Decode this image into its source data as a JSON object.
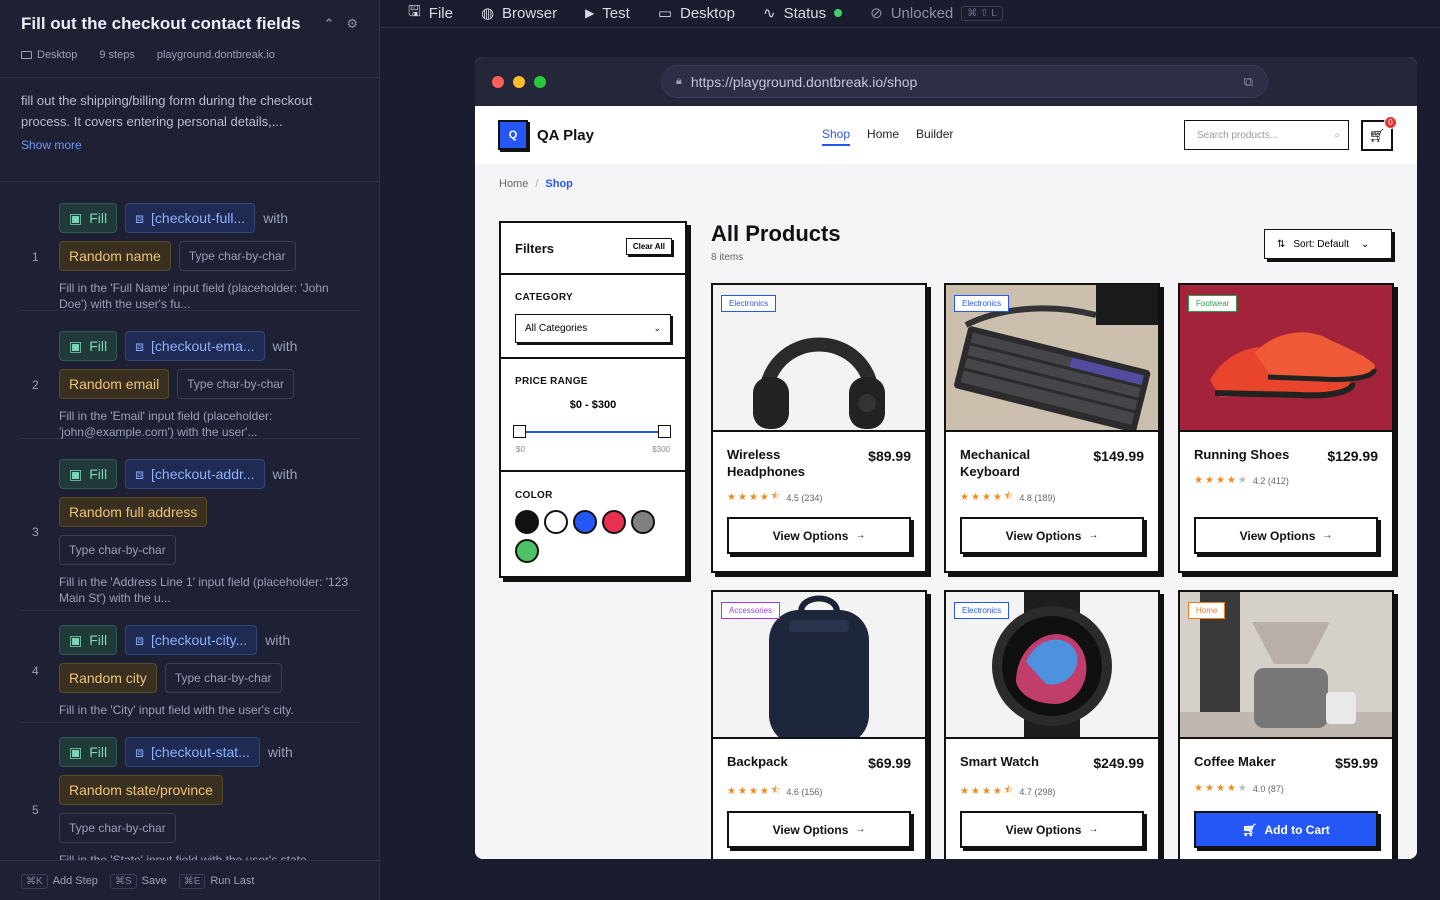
{
  "panel": {
    "title": "Fill out the checkout contact fields",
    "meta": {
      "device": "Desktop",
      "steps": "9 steps",
      "domain": "playground.dontbreak.io"
    },
    "description": "fill out the shipping/billing form during the checkout process. It covers entering personal details,...",
    "show_more": "Show more",
    "steps": [
      {
        "num": "1",
        "action": "Fill",
        "target": "[checkout-full...",
        "with": "with",
        "value": "Random name",
        "mode": "Type char-by-char",
        "desc": "Fill in the 'Full Name' input field (placeholder: 'John Doe') with the user's fu..."
      },
      {
        "num": "2",
        "action": "Fill",
        "target": "[checkout-ema...",
        "with": "with",
        "value": "Random email",
        "mode": "Type char-by-char",
        "desc": "Fill in the 'Email' input field (placeholder: 'john@example.com') with the user'..."
      },
      {
        "num": "3",
        "action": "Fill",
        "target": "[checkout-addr...",
        "with": "with",
        "value": "Random full address",
        "mode": "Type char-by-char",
        "desc": "Fill in the 'Address Line 1' input field (placeholder: '123 Main St') with the u..."
      },
      {
        "num": "4",
        "action": "Fill",
        "target": "[checkout-city...",
        "with": "with",
        "value": "Random city",
        "mode": "Type char-by-char",
        "desc": "Fill in the 'City' input field with the user's city."
      },
      {
        "num": "5",
        "action": "Fill",
        "target": "[checkout-stat...",
        "with": "with",
        "value": "Random state/province",
        "mode": "Type char-by-char",
        "desc": "Fill in the 'State' input field with the user's state..."
      }
    ],
    "footer": {
      "add_kbd": "⌘K",
      "add": "Add Step",
      "save_kbd": "⌘S",
      "save": "Save",
      "run_kbd": "⌘E",
      "run": "Run Last"
    }
  },
  "topbar": {
    "file": "File",
    "browser": "Browser",
    "test": "Test",
    "desktop": "Desktop",
    "status": "Status",
    "unlocked": "Unlocked",
    "unlock_kbd": "⌘ ⇧ L"
  },
  "browser": {
    "url": "https://playground.dontbreak.io/shop"
  },
  "shop": {
    "logo": "Q",
    "brand": "QA Play",
    "nav": [
      "Shop",
      "Home",
      "Builder"
    ],
    "search_placeholder": "Search products...",
    "cart_count": "0",
    "breadcrumb": {
      "home": "Home",
      "sep": "/",
      "current": "Shop"
    },
    "filters": {
      "title": "Filters",
      "clear": "Clear All",
      "category_label": "CATEGORY",
      "category_value": "All Categories",
      "price_label": "PRICE RANGE",
      "price_value": "$0 - $300",
      "min": "$0",
      "max": "$300",
      "color_label": "COLOR"
    },
    "colors": [
      "#111111",
      "#ffffff",
      "#2457f5",
      "#e8304f",
      "#808080",
      "#4cc265"
    ],
    "title": "All Products",
    "count": "8 items",
    "sort": "Sort: Default",
    "products": [
      {
        "name": "Wireless Headphones",
        "price": "$89.99",
        "tag": "Electronics",
        "rating": "4.5 (234)",
        "stars": 4.5,
        "button": "View Options"
      },
      {
        "name": "Mechanical Keyboard",
        "price": "$149.99",
        "tag": "Electronics",
        "rating": "4.8 (189)",
        "stars": 4.5,
        "button": "View Options"
      },
      {
        "name": "Running Shoes",
        "price": "$129.99",
        "tag": "Footwear",
        "rating": "4.2 (412)",
        "stars": 4,
        "button": "View Options"
      },
      {
        "name": "Backpack",
        "price": "$69.99",
        "tag": "Accessories",
        "rating": "4.6 (156)",
        "stars": 4.5,
        "button": "View Options"
      },
      {
        "name": "Smart Watch",
        "price": "$249.99",
        "tag": "Electronics",
        "rating": "4.7 (298)",
        "stars": 4.5,
        "button": "View Options"
      },
      {
        "name": "Coffee Maker",
        "price": "$59.99",
        "tag": "Home",
        "rating": "4.0 (87)",
        "stars": 4,
        "button": "Add to Cart"
      }
    ],
    "tag_colors": {
      "Electronics": "#2457f5",
      "Footwear": "#2e9e4f",
      "Accessories": "#9b3cf0",
      "Home": "#f07a1c"
    }
  }
}
